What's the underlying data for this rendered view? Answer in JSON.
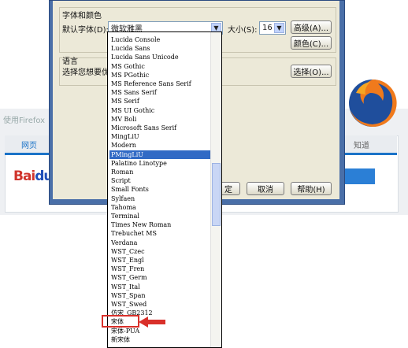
{
  "background": {
    "hint_text": "使用Firefox",
    "tab_web": "网页",
    "tab_zhidao": "知道",
    "logo_text_red": "Bai",
    "logo_text_blue": "du"
  },
  "dialog": {
    "fonts_colors_title": "字体和颜色",
    "default_font_label": "默认字体(D):",
    "default_font_value": "微软雅黑",
    "size_label": "大小(S):",
    "size_value": "16",
    "advanced_button": "高级(A)...",
    "colors_button": "颜色(C)...",
    "language_title": "语言",
    "language_desc": "选择您想要优先",
    "choose_button": "选择(O)...",
    "ok_button_partial": "定",
    "cancel_button": "取消",
    "help_button": "帮助(H)"
  },
  "font_list": [
    "Lucida Console",
    "Lucida Sans",
    "Lucida Sans Unicode",
    "MS Gothic",
    "MS PGothic",
    "MS Reference Sans Serif",
    "MS Sans Serif",
    "MS Serif",
    "MS UI Gothic",
    "MV Boli",
    "Microsoft Sans Serif",
    "MingLiU",
    "Modern",
    "PMingLiU",
    "Palatino Linotype",
    "Roman",
    "Script",
    "Small Fonts",
    "Sylfaen",
    "Tahoma",
    "Terminal",
    "Times New Roman",
    "Trebuchet MS",
    "Verdana",
    "WST_Czec",
    "WST_Engl",
    "WST_Fren",
    "WST_Germ",
    "WST_Ital",
    "WST_Span",
    "WST_Swed",
    "仿宋_GB2312",
    "宋体",
    "宋体-PUA",
    "新宋体"
  ],
  "selected_index": 13,
  "highlighted_index": 32,
  "colors": {
    "selection": "#316ac5",
    "highlight_box": "#d9302a",
    "dialog_face": "#ece9d8"
  }
}
